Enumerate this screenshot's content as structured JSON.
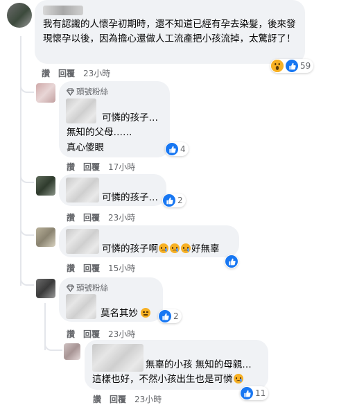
{
  "comments": [
    {
      "text": "我有認識的人懷孕初期時，還不知道已經有孕去染髮，後來發現懷孕以後，因為擔心還做人工流產把小孩流掉，太驚訝了！",
      "actions": {
        "like": "讚",
        "reply": "回覆",
        "time": "23小時"
      },
      "reaction_count": "59"
    },
    {
      "badge": "頭號粉絲",
      "line1": "可憐的孩子…",
      "line2": "無知的父母……",
      "line3": "真心傻眼",
      "actions": {
        "like": "讚",
        "reply": "回覆",
        "time": "17小時"
      },
      "reaction_count": "4"
    },
    {
      "text": "可憐的孩子…",
      "actions": {
        "like": "讚",
        "reply": "回覆",
        "time": "23小時"
      },
      "reaction_count": "2"
    },
    {
      "text_before": "可憐的孩子啊",
      "text_after": "好無辜",
      "actions": {
        "like": "讚",
        "reply": "回覆",
        "time": "15小時"
      }
    },
    {
      "badge": "頭號粉絲",
      "text": "莫名其妙",
      "actions": {
        "like": "讚",
        "reply": "回覆",
        "time": "23小時"
      },
      "reaction_count": "2"
    },
    {
      "line1": "無辜的小孩 無知的母親…",
      "line2": "這樣也好，不然小孩出生也是可憐",
      "actions": {
        "like": "讚",
        "reply": "回覆",
        "time": "23小時"
      },
      "reaction_count": "11"
    }
  ],
  "icons": {
    "badge": "diamond-badge-icon",
    "like": "like-reaction-icon",
    "wow": "wow-reaction-icon",
    "sad": "sad-cry-emoji-icon",
    "meh": "unamused-emoji-icon"
  },
  "colors": {
    "like": "#1877f2",
    "bubble": "#f0f2f5",
    "meta": "#65676b"
  }
}
